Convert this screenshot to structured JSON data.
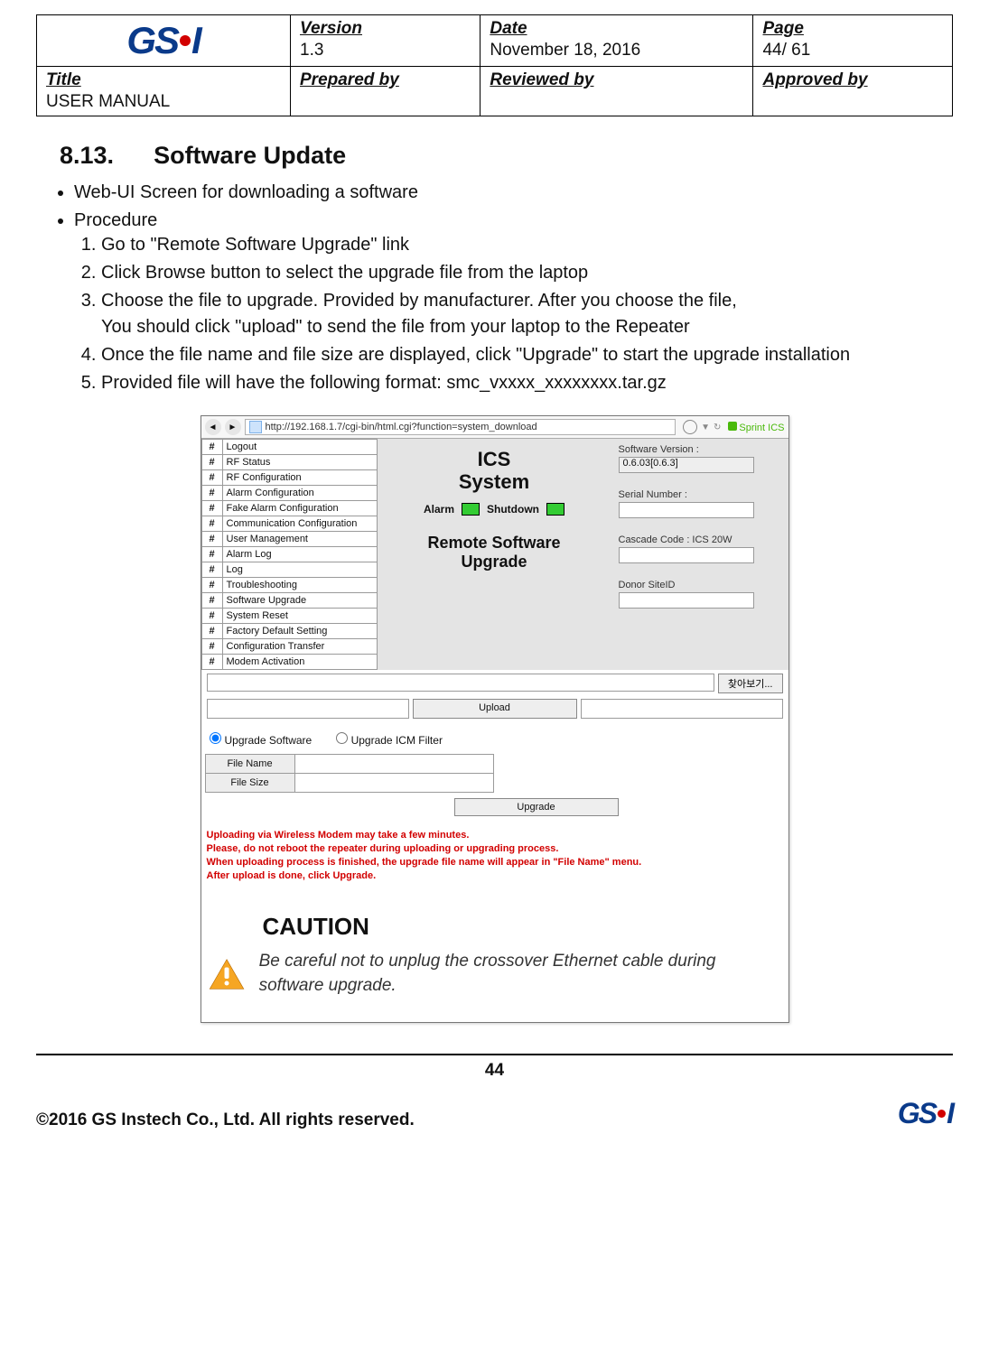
{
  "header": {
    "logo_text_1": "GS",
    "logo_text_2": "I",
    "version_label": "Version",
    "version_value": "1.3",
    "date_label": "Date",
    "date_value": "November 18, 2016",
    "page_label": "Page",
    "page_value": "44/ 61",
    "title_label": "Title",
    "title_value": "USER MANUAL",
    "prepared_label": "Prepared by",
    "reviewed_label": "Reviewed by",
    "approved_label": "Approved by"
  },
  "section": {
    "number": "8.13.",
    "title": "Software Update"
  },
  "bullets": {
    "b1": "Web-UI Screen for downloading a software",
    "b2": "Procedure"
  },
  "steps": {
    "s1": "Go to \"Remote Software Upgrade\" link",
    "s2": "Click Browse button to select the upgrade file from the laptop",
    "s3": "Choose the file to upgrade. Provided by manufacturer. After you choose the file,",
    "s3b": "You should click \"upload\" to send the file from your laptop to the Repeater",
    "s4": "Once the file name and file size are displayed, click \"Upgrade\" to start the upgrade installation",
    "s5": "Provided file will have the following format: smc_vxxxx_xxxxxxxx.tar.gz"
  },
  "webui": {
    "url": "http://192.168.1.7/cgi-bin/html.cgi?function=system_download",
    "sprint_label": "Sprint ICS",
    "nav_items": [
      "Logout",
      "RF Status",
      "RF Configuration",
      "Alarm Configuration",
      "Fake Alarm Configuration",
      "Communication Configuration",
      "User Management",
      "Alarm Log",
      "Log",
      "Troubleshooting",
      "Software Upgrade",
      "System Reset",
      "Factory Default Setting",
      "Configuration Transfer",
      "Modem Activation"
    ],
    "center": {
      "ics_line1": "ICS",
      "ics_line2": "System",
      "alarm_label": "Alarm",
      "shutdown_label": "Shutdown",
      "page_title_line1": "Remote Software",
      "page_title_line2": "Upgrade"
    },
    "right": {
      "sw_ver_label": "Software Version :",
      "sw_ver_value": "0.6.03[0.6.3]",
      "serial_label": "Serial Number :",
      "serial_value": "",
      "cascade_label": "Cascade Code : ICS 20W",
      "cascade_value": "",
      "donor_label": "Donor SiteID",
      "donor_value": ""
    },
    "controls": {
      "browse_label": "찾아보기...",
      "upload_label": "Upload",
      "radio_sw": "Upgrade Software",
      "radio_icm": "Upgrade ICM Filter",
      "file_name_label": "File Name",
      "file_name_value": "",
      "file_size_label": "File Size",
      "file_size_value": "",
      "upgrade_label": "Upgrade"
    },
    "warning": {
      "l1": "Uploading via Wireless Modem may take a few minutes.",
      "l2": "Please, do not reboot the repeater during uploading or upgrading process.",
      "l3": "When uploading process is finished, the upgrade file name will appear in \"File Name\" menu.",
      "l4": "After upload is done, click Upgrade."
    }
  },
  "caution": {
    "heading": "CAUTION",
    "text": "Be careful not to unplug the crossover Ethernet cable during software upgrade."
  },
  "footer": {
    "page_number": "44",
    "copyright": "©2016 GS Instech Co., Ltd.    All rights reserved."
  }
}
